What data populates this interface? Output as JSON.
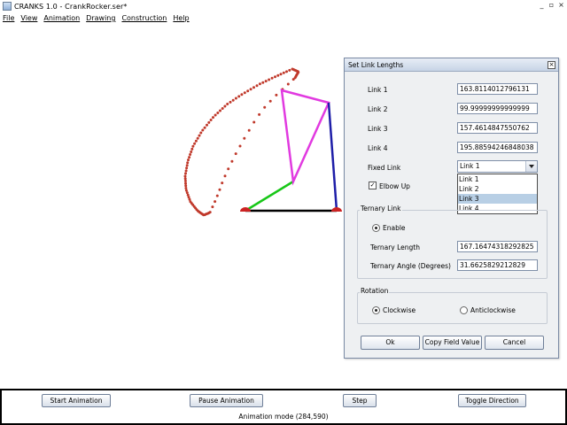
{
  "window": {
    "title": "CRANKS 1.0 - CrankRocker.ser*",
    "buttons": [
      "_",
      "▫",
      "×"
    ]
  },
  "menu": [
    "File",
    "View",
    "Animation",
    "Drawing",
    "Construction",
    "Help"
  ],
  "colors": {
    "trace": "#c0392b",
    "link1": "#18c718",
    "link2": "#e13ae0",
    "link3": "#1e1ea8",
    "ground": "#000000",
    "pivot": "#cc2222"
  },
  "dialog": {
    "title": "Set Link Lengths",
    "close": "×",
    "fields": [
      {
        "label": "Link 1",
        "value": "163.8114012796131"
      },
      {
        "label": "Link 2",
        "value": "99.99999999999999"
      },
      {
        "label": "Link 3",
        "value": "157.4614847550762"
      },
      {
        "label": "Link 4",
        "value": "195.88594246848038"
      }
    ],
    "fixed_link_label": "Fixed Link",
    "fixed_link_value": "Link 1",
    "fixed_link_options": [
      "Link 1",
      "Link 2",
      "Link 3",
      "Link 4"
    ],
    "fixed_link_highlighted": "Link 3",
    "elbow_up_label": "Elbow Up",
    "elbow_up_checked": true,
    "ternary": {
      "group_title": "Ternary Link",
      "enable_label": "Enable",
      "enable_selected": true,
      "length_label": "Ternary Length",
      "length_value": "167.16474318292825",
      "angle_label": "Ternary Angle (Degrees)",
      "angle_value": "31.6625829212829"
    },
    "rotation": {
      "group_title": "Rotation",
      "clockwise_label": "Clockwise",
      "anticlockwise_label": "Anticlockwise",
      "selected": "Clockwise"
    },
    "buttons": {
      "ok": "Ok",
      "copy": "Copy Field Value",
      "cancel": "Cancel"
    }
  },
  "controls": {
    "start": "Start Animation",
    "pause": "Pause Animation",
    "step": "Step",
    "toggle": "Toggle Direction"
  },
  "status": "Animation mode  (284,590)"
}
